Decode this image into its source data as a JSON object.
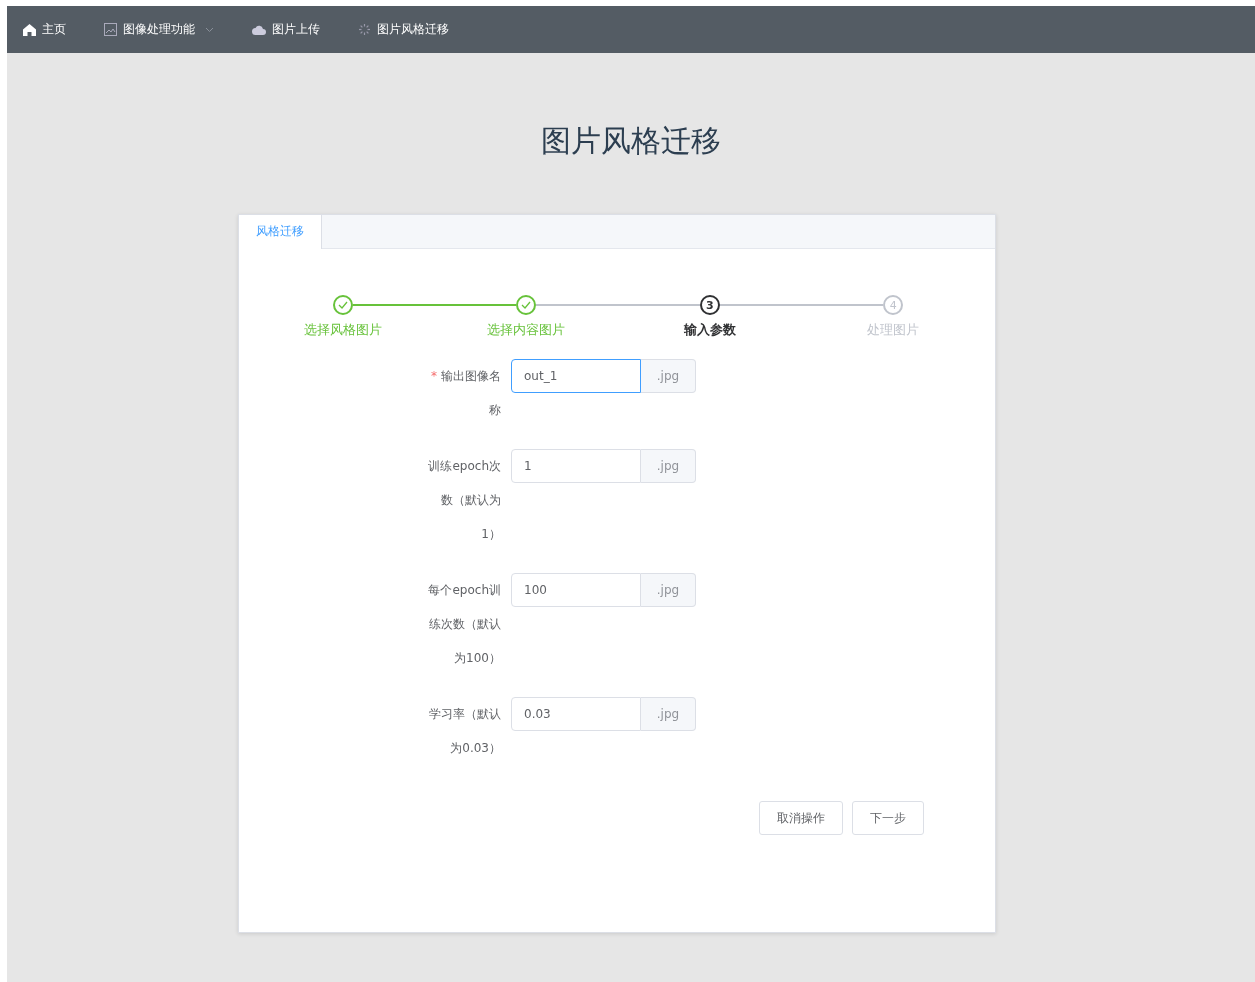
{
  "nav": [
    {
      "label": "主页",
      "dropdown": false
    },
    {
      "label": "图像处理功能",
      "dropdown": true
    },
    {
      "label": "图片上传",
      "dropdown": false
    },
    {
      "label": "图片风格迁移",
      "dropdown": false
    }
  ],
  "title": "图片风格迁移",
  "tabs": [
    {
      "label": "风格迁移",
      "selected": true
    }
  ],
  "steps": [
    {
      "label": "选择风格图片",
      "done": true,
      "active": false
    },
    {
      "label": "选择内容图片",
      "done": true,
      "active": false
    },
    {
      "label": "输入参数",
      "number": "3",
      "done": false,
      "active": true
    },
    {
      "label": "处理图片",
      "number": "4",
      "done": false,
      "active": false
    }
  ],
  "fields": [
    {
      "label": "输出图像名称",
      "required_mark": "*",
      "value": "out_1",
      "suffix": ".jpg",
      "focused": true
    },
    {
      "label": "训练epoch次数（默认为1）",
      "value": "1",
      "suffix": ".jpg",
      "focused": false
    },
    {
      "label": "每个epoch训练次数（默认为100）",
      "value": "100",
      "suffix": ".jpg",
      "focused": false
    },
    {
      "label": "学习率（默认为0.03）",
      "value": "0.03",
      "suffix": ".jpg",
      "focused": false
    }
  ],
  "buttons": [
    "取消操作",
    "下一步"
  ]
}
